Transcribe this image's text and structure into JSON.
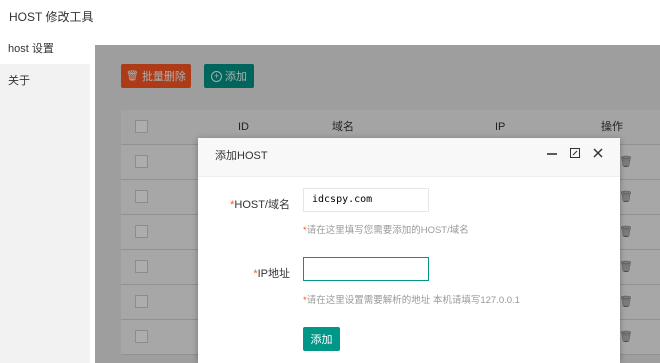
{
  "app": {
    "title": "HOST 修改工具"
  },
  "sidebar": {
    "items": [
      {
        "label": "host 设置"
      },
      {
        "label": "关于"
      }
    ]
  },
  "toolbar": {
    "batch_delete_label": "批量删除",
    "add_label": "添加"
  },
  "table": {
    "columns": [
      "ID",
      "域名",
      "IP",
      "操作"
    ],
    "row_count_visible": 6
  },
  "modal": {
    "title": "添加HOST",
    "host_field": {
      "label": "HOST/域名",
      "value": "idcspy.com",
      "hint": "请在这里填写您需要添加的HOST/域名"
    },
    "ip_field": {
      "label": "IP地址",
      "value": "",
      "hint": "请在这里设置需要解析的地址 本机请填写127.0.0.1"
    },
    "submit_label": "添加"
  },
  "colors": {
    "primary": "#009688",
    "danger": "#ff5722"
  }
}
